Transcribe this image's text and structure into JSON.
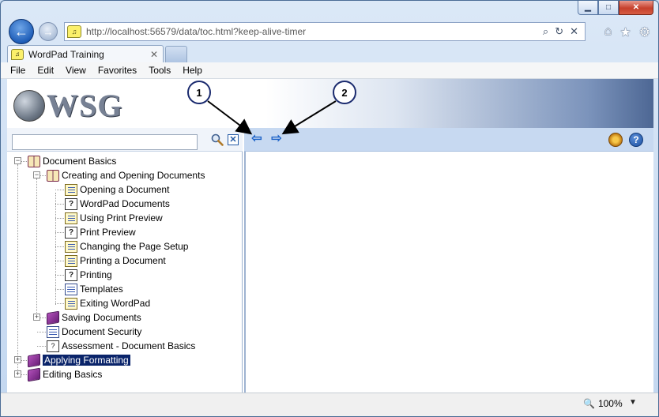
{
  "browser": {
    "address": "http://localhost:56579/data/toc.html?keep-alive-timer",
    "tab_title": "WordPad Training",
    "tab_close": "✕",
    "menu": [
      "File",
      "Edit",
      "View",
      "Favorites",
      "Tools",
      "Help"
    ],
    "zoom": "100%"
  },
  "banner": {
    "logo_text": "WSG"
  },
  "callouts": [
    "1",
    "2"
  ],
  "toc": {
    "items": [
      {
        "label": "Document Basics"
      },
      {
        "label": "Creating and Opening Documents"
      },
      {
        "label": "Opening a Document"
      },
      {
        "label": "WordPad Documents"
      },
      {
        "label": "Using Print Preview"
      },
      {
        "label": "Print Preview"
      },
      {
        "label": "Changing the Page Setup"
      },
      {
        "label": "Printing a Document"
      },
      {
        "label": "Printing"
      },
      {
        "label": "Templates"
      },
      {
        "label": "Exiting WordPad"
      },
      {
        "label": "Saving Documents"
      },
      {
        "label": "Document Security"
      },
      {
        "label": "Assessment - Document Basics"
      },
      {
        "label": "Applying Formatting"
      },
      {
        "label": "Editing Basics"
      }
    ]
  }
}
